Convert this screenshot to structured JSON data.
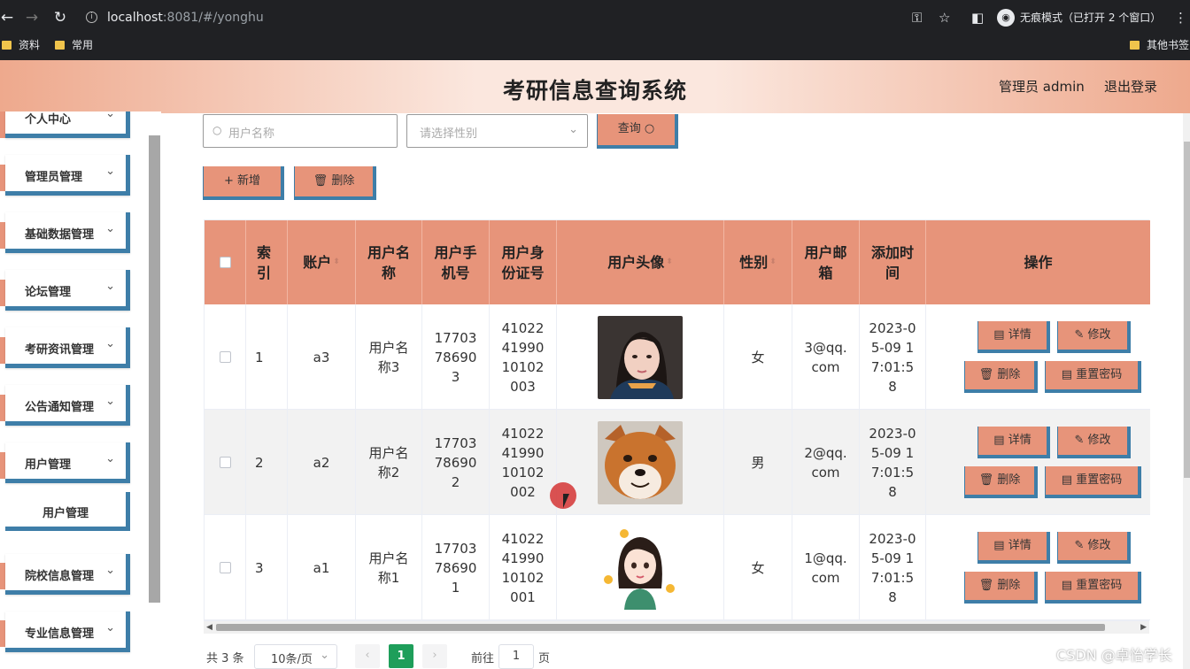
{
  "browser": {
    "url_host": "localhost",
    "url_rest": ":8081/#/yonghu",
    "profile_text": "无痕模式（已打开 2 个窗口）",
    "bookmarks": [
      "资料",
      "常用"
    ],
    "other_bookmarks": "其他书签"
  },
  "header": {
    "title": "考研信息查询系统",
    "admin": "管理员 admin",
    "logout": "退出登录"
  },
  "sidebar": {
    "items": [
      {
        "label": "个人中心"
      },
      {
        "label": "管理员管理"
      },
      {
        "label": "基础数据管理"
      },
      {
        "label": "论坛管理"
      },
      {
        "label": "考研资讯管理"
      },
      {
        "label": "公告通知管理"
      },
      {
        "label": "用户管理"
      },
      {
        "label": "院校信息管理"
      },
      {
        "label": "专业信息管理"
      }
    ],
    "sub_item": "用户管理"
  },
  "search": {
    "username_placeholder": "用户名称",
    "gender_placeholder": "请选择性别",
    "query_label": "查询"
  },
  "actions": {
    "add_label": "新增",
    "delete_label": "删除"
  },
  "table": {
    "headers": [
      "索引",
      "账户",
      "用户名称",
      "用户手机号",
      "用户身份证号",
      "用户头像",
      "性别",
      "用户邮箱",
      "添加时间",
      "操作"
    ],
    "rows": [
      {
        "index": "1",
        "account": "a3",
        "name": "用户名称3",
        "phone": "17703786903",
        "id_card": "410224199010102003",
        "avatar": "female-portrait-photo",
        "gender": "女",
        "email": "3@qq.com",
        "added": "2023-05-09 17:01:58"
      },
      {
        "index": "2",
        "account": "a2",
        "name": "用户名称2",
        "phone": "17703786902",
        "id_card": "410224199010102002",
        "avatar": "shiba-dog-photo",
        "gender": "男",
        "email": "2@qq.com",
        "added": "2023-05-09 17:01:58"
      },
      {
        "index": "3",
        "account": "a1",
        "name": "用户名称1",
        "phone": "17703786901",
        "id_card": "410224199010102001",
        "avatar": "cartoon-girl-sticker",
        "gender": "女",
        "email": "1@qq.com",
        "added": "2023-05-09 17:01:58"
      }
    ],
    "row_actions": {
      "detail": "详情",
      "edit": "修改",
      "delete": "删除",
      "reset_password": "重置密码"
    }
  },
  "pagination": {
    "total": "共 3 条",
    "page_size": "10条/页",
    "current_page": "1",
    "goto_prefix": "前往",
    "goto_value": "1",
    "goto_suffix": "页"
  },
  "watermark": "CSDN @卓怡学长",
  "colors": {
    "accent": "#e7947a",
    "border_accent": "#3e7ea8",
    "active_page": "#1e9e5a"
  }
}
